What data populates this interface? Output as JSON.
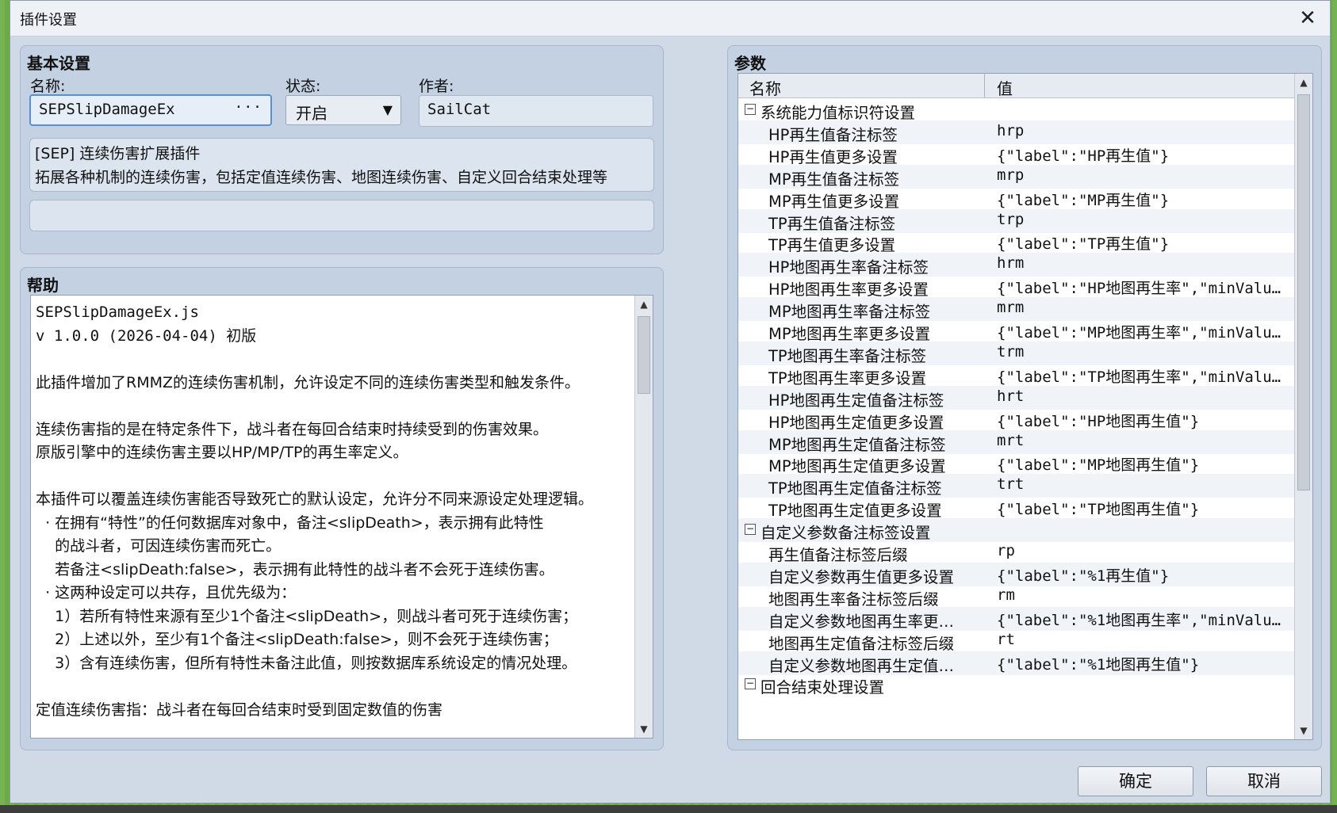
{
  "window": {
    "title": "插件设置"
  },
  "basic": {
    "title": "基本设置",
    "name_label": "名称:",
    "name_value": "SEPSlipDamageEx",
    "name_more": "···",
    "status_label": "状态:",
    "status_value": "开启",
    "author_label": "作者:",
    "author_value": "SailCat",
    "desc_line1": "[SEP] 连续伤害扩展插件",
    "desc_line2": "拓展各种机制的连续伤害，包括定值连续伤害、地图连续伤害、自定义回合结束处理等"
  },
  "help": {
    "title": "帮助",
    "lines": [
      "SEPSlipDamageEx.js",
      "v 1.0.0 (2026-04-04) 初版",
      "",
      "此插件增加了RMMZ的连续伤害机制，允许设定不同的连续伤害类型和触发条件。",
      "",
      "连续伤害指的是在特定条件下，战斗者在每回合结束时持续受到的伤害效果。",
      "原版引擎中的连续伤害主要以HP/MP/TP的再生率定义。",
      "",
      "本插件可以覆盖连续伤害能否导致死亡的默认设定，允许分不同来源设定处理逻辑。",
      "  · 在拥有“特性”的任何数据库对象中，备注<slipDeath>，表示拥有此特性",
      "    的战斗者，可因连续伤害而死亡。",
      "    若备注<slipDeath:false>，表示拥有此特性的战斗者不会死于连续伤害。",
      "  · 这两种设定可以共存，且优先级为：",
      "    1）若所有特性来源有至少1个备注<slipDeath>，则战斗者可死于连续伤害；",
      "    2）上述以外，至少有1个备注<slipDeath:false>，则不会死于连续伤害；",
      "    3）含有连续伤害，但所有特性未备注此值，则按数据库系统设定的情况处理。",
      "",
      "定值连续伤害指：战斗者在每回合结束时受到固定数值的伤害"
    ]
  },
  "params": {
    "title": "参数",
    "col_name": "名称",
    "col_value": "值",
    "rows": [
      {
        "type": "group",
        "name": "系统能力值标识符设置",
        "value": ""
      },
      {
        "type": "item",
        "name": "HP再生值备注标签",
        "value": "hrp"
      },
      {
        "type": "item",
        "name": "HP再生值更多设置",
        "value": "{\"label\":\"HP再生值\"}"
      },
      {
        "type": "item",
        "name": "MP再生值备注标签",
        "value": "mrp"
      },
      {
        "type": "item",
        "name": "MP再生值更多设置",
        "value": "{\"label\":\"MP再生值\"}"
      },
      {
        "type": "item",
        "name": "TP再生值备注标签",
        "value": "trp"
      },
      {
        "type": "item",
        "name": "TP再生值更多设置",
        "value": "{\"label\":\"TP再生值\"}"
      },
      {
        "type": "item",
        "name": "HP地图再生率备注标签",
        "value": "hrm"
      },
      {
        "type": "item",
        "name": "HP地图再生率更多设置",
        "value": "{\"label\":\"HP地图再生率\",\"minValu…"
      },
      {
        "type": "item",
        "name": "MP地图再生率备注标签",
        "value": "mrm"
      },
      {
        "type": "item",
        "name": "MP地图再生率更多设置",
        "value": "{\"label\":\"MP地图再生率\",\"minValu…"
      },
      {
        "type": "item",
        "name": "TP地图再生率备注标签",
        "value": "trm"
      },
      {
        "type": "item",
        "name": "TP地图再生率更多设置",
        "value": "{\"label\":\"TP地图再生率\",\"minValu…"
      },
      {
        "type": "item",
        "name": "HP地图再生定值备注标签",
        "value": "hrt"
      },
      {
        "type": "item",
        "name": "HP地图再生定值更多设置",
        "value": "{\"label\":\"HP地图再生值\"}"
      },
      {
        "type": "item",
        "name": "MP地图再生定值备注标签",
        "value": "mrt"
      },
      {
        "type": "item",
        "name": "MP地图再生定值更多设置",
        "value": "{\"label\":\"MP地图再生值\"}"
      },
      {
        "type": "item",
        "name": "TP地图再生定值备注标签",
        "value": "trt"
      },
      {
        "type": "item",
        "name": "TP地图再生定值更多设置",
        "value": "{\"label\":\"TP地图再生值\"}"
      },
      {
        "type": "group",
        "name": "自定义参数备注标签设置",
        "value": ""
      },
      {
        "type": "item",
        "name": "再生值备注标签后缀",
        "value": "rp"
      },
      {
        "type": "item",
        "name": "自定义参数再生值更多设置",
        "value": "{\"label\":\"%1再生值\"}"
      },
      {
        "type": "item",
        "name": "地图再生率备注标签后缀",
        "value": "rm"
      },
      {
        "type": "item",
        "name": "自定义参数地图再生率更…",
        "value": "{\"label\":\"%1地图再生率\",\"minValu…"
      },
      {
        "type": "item",
        "name": "地图再生定值备注标签后缀",
        "value": "rt"
      },
      {
        "type": "item",
        "name": "自定义参数地图再生定值…",
        "value": "{\"label\":\"%1地图再生值\"}"
      },
      {
        "type": "group",
        "name": "回合结束处理设置",
        "value": ""
      }
    ]
  },
  "buttons": {
    "ok": "确定",
    "cancel": "取消"
  },
  "icons": {
    "close": "close-icon",
    "expander": "minus-icon",
    "scroll_up": "up-arrow-icon",
    "scroll_down": "down-arrow-icon"
  }
}
